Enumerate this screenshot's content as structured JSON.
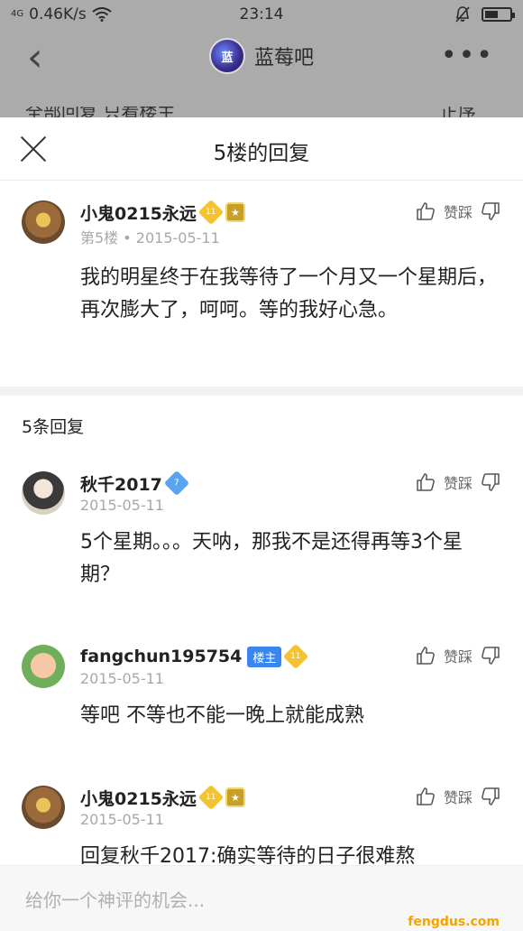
{
  "status_bar": {
    "signal": "4G",
    "network_speed": "0.46K/s",
    "time": "23:14",
    "battery_level": 0.55
  },
  "background_page": {
    "forum_logo_text": "蓝",
    "forum_name": "蓝莓吧",
    "tab_left": "全部回复 只看楼主",
    "tab_right": "正序"
  },
  "sheet": {
    "title": "5楼的回复",
    "main_comment": {
      "username": "小鬼0215永远",
      "level": "11",
      "floor": "第5楼",
      "date": "2015-05-11",
      "text": "我的明星终于在我等待了一个月又一个星期后，再次膨大了，呵呵。等的我好心急。",
      "action_label": "赞踩"
    },
    "replies_count": "5条回复",
    "replies": [
      {
        "username": "秋千2017",
        "level": "7",
        "date": "2015-05-11",
        "text": "5个星期。。。天呐，那我不是还得再等3个星期？",
        "action_label": "赞踩"
      },
      {
        "username": "fangchun195754",
        "host_tag": "楼主",
        "level": "11",
        "date": "2015-05-11",
        "text": "等吧 不等也不能一晚上就能成熟",
        "action_label": "赞踩"
      },
      {
        "username": "小鬼0215永远",
        "level": "11",
        "date": "2015-05-11",
        "text": "回复秋千2017:确实等待的日子很难熬",
        "action_label": "赞踩"
      }
    ],
    "input_placeholder": "给你一个神评的机会...",
    "watermark": "fengdus.com"
  }
}
